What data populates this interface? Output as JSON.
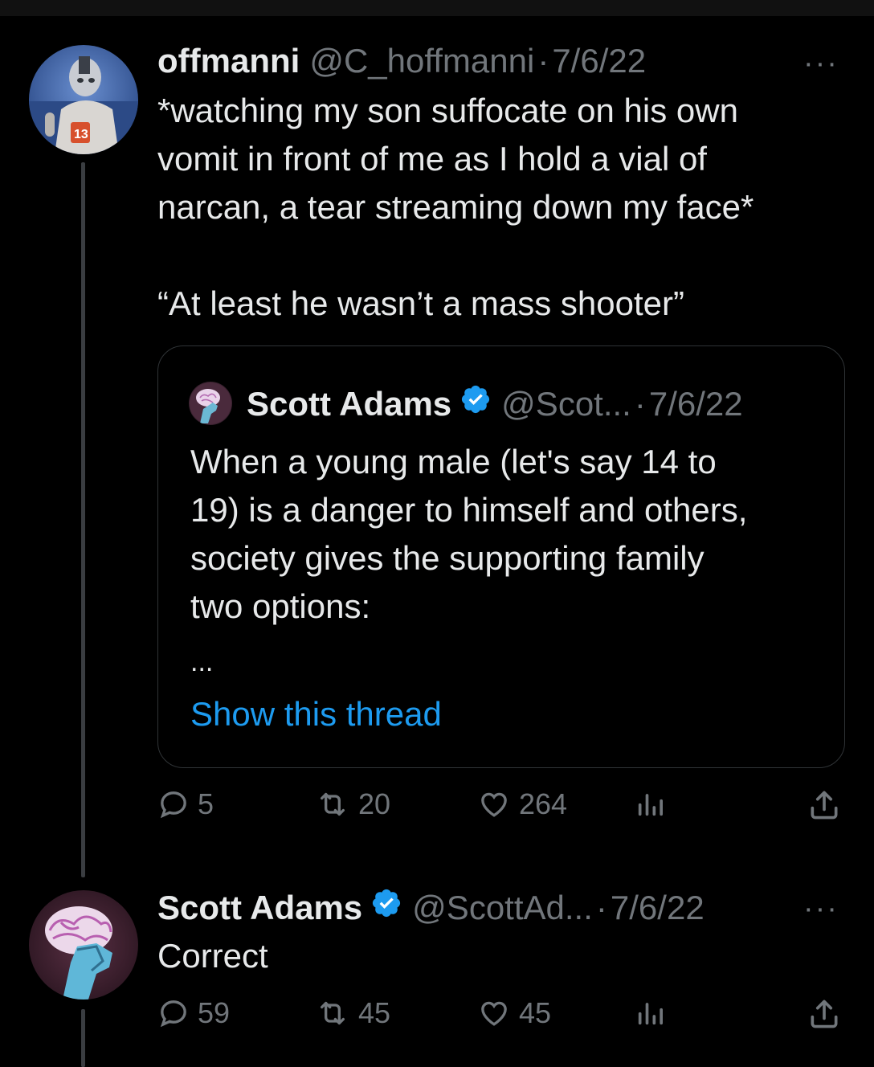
{
  "tweet1": {
    "name": "offmanni",
    "handle": "@C_hoffmanni",
    "sep": "·",
    "date": "7/6/22",
    "more": "···",
    "text": "*watching my son suffocate on his own\nvomit in front of me as I hold a vial of\nnarcan, a tear streaming down my face*\n\n“At least he wasn’t a mass shooter”",
    "quote": {
      "name": "Scott Adams",
      "handle": "@Scot...",
      "sep": "·",
      "date": "7/6/22",
      "text": "When a young male (let's say 14 to\n19) is a danger to himself and others,\nsociety gives the supporting family\ntwo options:",
      "ellipsis": "...",
      "show_thread": "Show this thread"
    },
    "actions": {
      "replies": "5",
      "retweets": "20",
      "likes": "264"
    }
  },
  "tweet2": {
    "name": "Scott Adams",
    "handle": "@ScottAd...",
    "sep": "·",
    "date": "7/6/22",
    "more": "···",
    "text": "Correct",
    "actions": {
      "replies": "59",
      "retweets": "45",
      "likes": "45"
    }
  },
  "colors": {
    "background": "#000000",
    "text": "#e7e9ea",
    "muted": "#71767b",
    "link": "#1d9bf0",
    "verified": "#1d9bf0"
  },
  "icons": [
    "reply-icon",
    "retweet-icon",
    "like-icon",
    "views-icon",
    "share-icon",
    "verified-badge-icon",
    "more-icon"
  ]
}
